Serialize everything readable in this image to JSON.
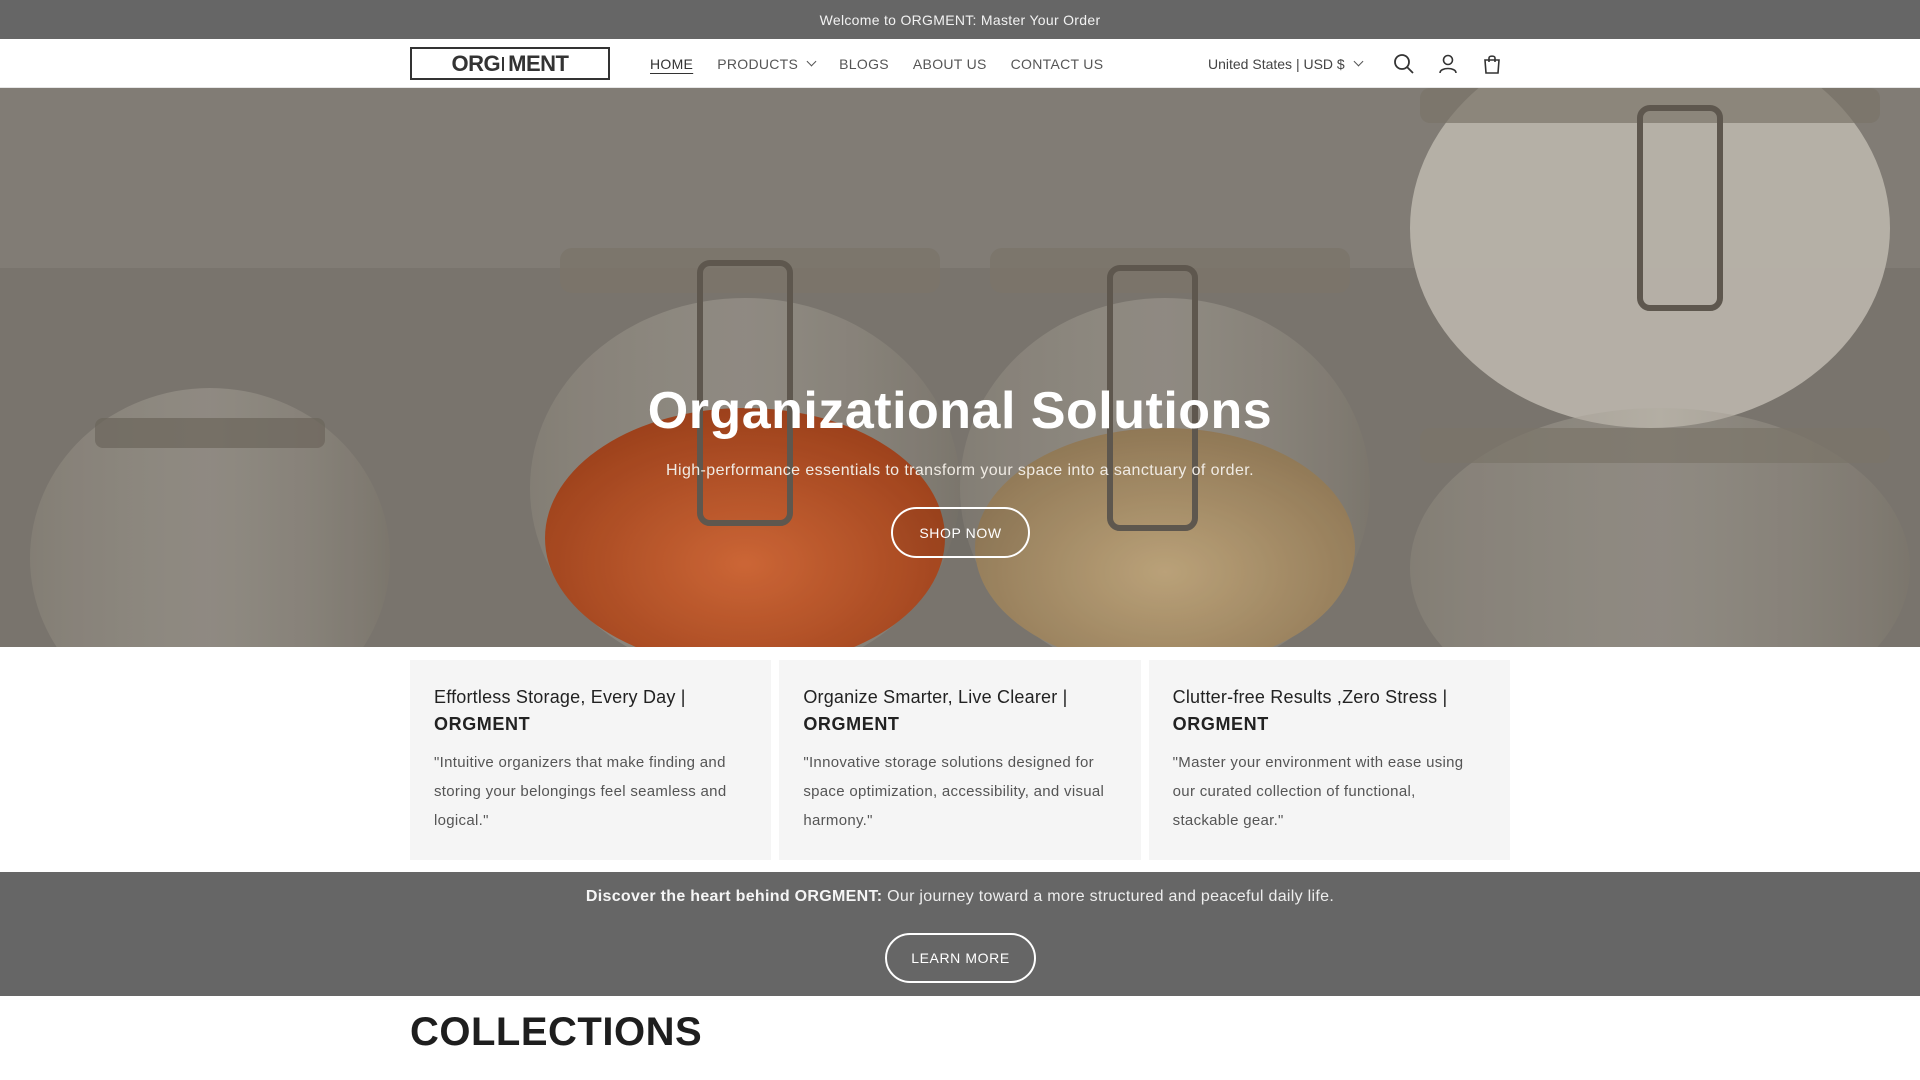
{
  "announcement": {
    "text": "Welcome to ORGMENT: Master Your Order"
  },
  "header": {
    "logo_left": "ORG",
    "logo_right": "MENT",
    "nav": [
      {
        "label": "HOME",
        "active": true
      },
      {
        "label": "PRODUCTS",
        "has_dropdown": true
      },
      {
        "label": "BLOGS"
      },
      {
        "label": "ABOUT US"
      },
      {
        "label": "CONTACT US"
      }
    ],
    "locale": "United States | USD $",
    "icons": [
      "search-icon",
      "account-icon",
      "cart-icon"
    ]
  },
  "hero": {
    "title": "Organizational Solutions",
    "subtitle": "High-performance essentials to transform your space into a sanctuary of order.",
    "button": "SHOP NOW"
  },
  "features": [
    {
      "title": "Effortless Storage, Every Day |",
      "brand": "ORGMENT",
      "text": "\"Intuitive organizers that make finding and storing your belongings feel seamless and logical.\""
    },
    {
      "title": "Organize Smarter, Live Clearer |",
      "brand": "ORGMENT",
      "text": "\"Innovative storage solutions designed for space optimization, accessibility, and visual harmony.\""
    },
    {
      "title": "Clutter-free Results ,Zero Stress |",
      "brand": "ORGMENT",
      "text": "\"Master your environment with ease using our curated collection of functional, stackable gear.\""
    }
  ],
  "story": {
    "bold": "Discover the heart behind ORGMENT:",
    "text": " Our journey toward a more structured and peaceful daily life.",
    "button": "LEARN MORE"
  },
  "collections": {
    "heading": "COLLECTIONS"
  },
  "colors": {
    "bar": "#666666",
    "white": "#ffffff",
    "card": "#f5f5f5"
  }
}
